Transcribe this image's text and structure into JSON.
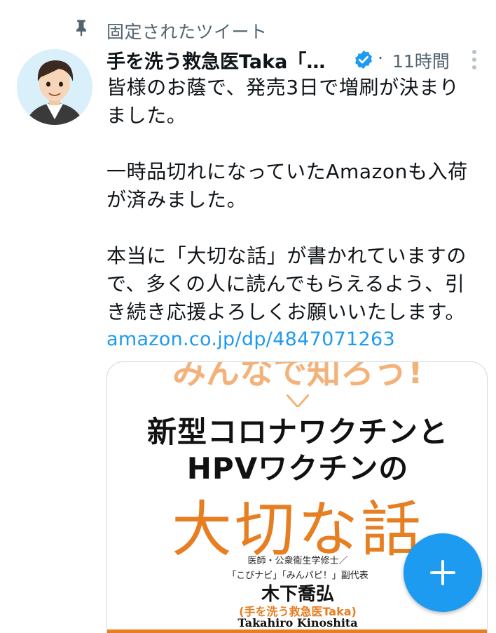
{
  "pinned": {
    "label": "固定されたツイート"
  },
  "author": {
    "display_name": "手を洗う救急医Taka「…",
    "verified": true
  },
  "meta": {
    "separator": "·",
    "timestamp": "11時間"
  },
  "tweet": {
    "text": "皆様のお蔭で、発売3日で増刷が決まり\nました。\n\n一時品切れになっていたAmazonも入荷\nが済みました。\n\n本当に「大切な話」が書かれていますの\nで、多くの人に読んでもらえるよう、引\nき続き応援よろしくお願いいたします。",
    "link": "amazon.co.jp/dp/4847071263"
  },
  "card": {
    "tagline": "みんなで知ろう!",
    "title_line1": "新型コロナワクチンと",
    "title_line2": "HPVワクチンの",
    "title_big": "大切な話",
    "author_role1": "医師・公衆衛生学修士／",
    "author_role2": "「こびナビ」「みんパピ！」副代表",
    "author_name": "木下喬弘",
    "author_nick": "(手を洗う救急医Taka)",
    "author_roman": "Takahiro Kinoshita"
  },
  "colors": {
    "accent": "#1d9bf0",
    "secondary_text": "#536471",
    "book_orange": "#e67e22"
  },
  "icons": {
    "pin": "pin-icon",
    "verified": "verified-badge-icon",
    "more": "more-vertical-icon",
    "fab": "plus-icon"
  }
}
